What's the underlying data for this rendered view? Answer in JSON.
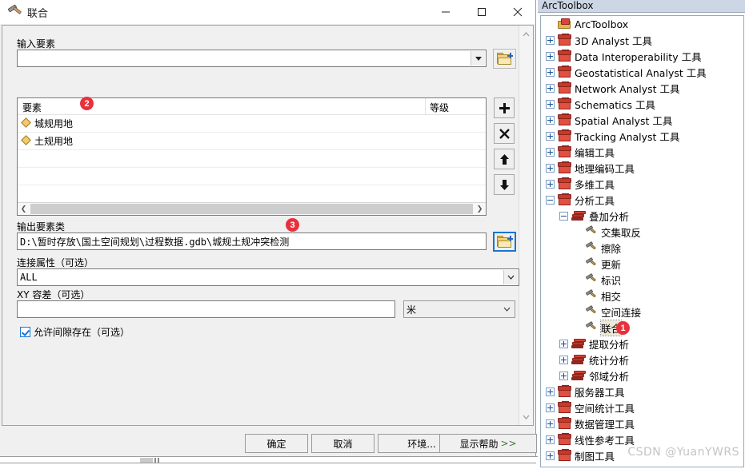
{
  "dialog": {
    "title": "联合",
    "title_icon": "hammer-icon",
    "window_buttons": {
      "minimize": "—",
      "maximize": "▢",
      "close": "✕"
    },
    "input_features": {
      "label": "输入要素",
      "value": "",
      "placeholder": "",
      "browse_icon": "folder-add-icon"
    },
    "feature_list": {
      "columns": [
        "要素",
        "等级"
      ],
      "rows": [
        {
          "icon": "polygon-diamond-icon",
          "name": "城规用地",
          "rank": ""
        },
        {
          "icon": "polygon-diamond-icon",
          "name": "土规用地",
          "rank": ""
        }
      ],
      "side_buttons": [
        {
          "name": "add-button",
          "glyph": "✚"
        },
        {
          "name": "remove-button",
          "glyph": "✖"
        },
        {
          "name": "move-up-button",
          "glyph": "⬆"
        },
        {
          "name": "move-down-button",
          "glyph": "⬇"
        }
      ]
    },
    "output_feature_class": {
      "label": "输出要素类",
      "value": "D:\\暂时存放\\国土空间规划\\过程数据.gdb\\城规土规冲突检测",
      "browse_icon": "folder-add-icon"
    },
    "join_attributes": {
      "label": "连接属性（可选）",
      "value": "ALL"
    },
    "xy_tolerance": {
      "label": "XY 容差（可选）",
      "value": "",
      "unit": "米"
    },
    "gaps_allowed": {
      "label": "允许间隙存在（可选）",
      "checked": true
    },
    "footer_buttons": [
      {
        "name": "ok-button",
        "label": "确定"
      },
      {
        "name": "cancel-button",
        "label": "取消"
      },
      {
        "name": "environments-button",
        "label": "环境..."
      },
      {
        "name": "show-help-button",
        "label": "显示帮助",
        "suffix": ">>"
      }
    ]
  },
  "toolbox": {
    "header": "ArcToolbox",
    "root": {
      "label": "ArcToolbox",
      "icon": "arctoolbox-root-icon"
    },
    "items": [
      {
        "label": "3D Analyst 工具",
        "icon": "toolbox-icon",
        "expander": "plus",
        "indent": 0
      },
      {
        "label": "Data Interoperability 工具",
        "icon": "toolbox-icon",
        "expander": "plus",
        "indent": 0
      },
      {
        "label": "Geostatistical Analyst 工具",
        "icon": "toolbox-icon",
        "expander": "plus",
        "indent": 0
      },
      {
        "label": "Network Analyst 工具",
        "icon": "toolbox-icon",
        "expander": "plus",
        "indent": 0
      },
      {
        "label": "Schematics 工具",
        "icon": "toolbox-icon",
        "expander": "plus",
        "indent": 0
      },
      {
        "label": "Spatial Analyst 工具",
        "icon": "toolbox-icon",
        "expander": "plus",
        "indent": 0
      },
      {
        "label": "Tracking Analyst 工具",
        "icon": "toolbox-icon",
        "expander": "plus",
        "indent": 0
      },
      {
        "label": "编辑工具",
        "icon": "toolbox-icon",
        "expander": "plus",
        "indent": 0
      },
      {
        "label": "地理编码工具",
        "icon": "toolbox-icon",
        "expander": "plus",
        "indent": 0
      },
      {
        "label": "多维工具",
        "icon": "toolbox-icon",
        "expander": "plus",
        "indent": 0
      },
      {
        "label": "分析工具",
        "icon": "toolbox-icon",
        "expander": "minus",
        "indent": 0
      },
      {
        "label": "叠加分析",
        "icon": "toolset-icon",
        "expander": "minus",
        "indent": 1
      },
      {
        "label": "交集取反",
        "icon": "hammer-icon",
        "expander": "none",
        "indent": 2
      },
      {
        "label": "擦除",
        "icon": "hammer-icon",
        "expander": "none",
        "indent": 2
      },
      {
        "label": "更新",
        "icon": "hammer-icon",
        "expander": "none",
        "indent": 2
      },
      {
        "label": "标识",
        "icon": "hammer-icon",
        "expander": "none",
        "indent": 2
      },
      {
        "label": "相交",
        "icon": "hammer-icon",
        "expander": "none",
        "indent": 2
      },
      {
        "label": "空间连接",
        "icon": "hammer-icon",
        "expander": "none",
        "indent": 2
      },
      {
        "label": "联合",
        "icon": "hammer-icon",
        "expander": "none",
        "indent": 2,
        "selected": true
      },
      {
        "label": "提取分析",
        "icon": "toolset-icon",
        "expander": "plus",
        "indent": 1
      },
      {
        "label": "统计分析",
        "icon": "toolset-icon",
        "expander": "plus",
        "indent": 1
      },
      {
        "label": "邻域分析",
        "icon": "toolset-icon",
        "expander": "plus",
        "indent": 1
      },
      {
        "label": "服务器工具",
        "icon": "toolbox-icon",
        "expander": "plus",
        "indent": 0
      },
      {
        "label": "空间统计工具",
        "icon": "toolbox-icon",
        "expander": "plus",
        "indent": 0
      },
      {
        "label": "数据管理工具",
        "icon": "toolbox-icon",
        "expander": "plus",
        "indent": 0
      },
      {
        "label": "线性参考工具",
        "icon": "toolbox-icon",
        "expander": "plus",
        "indent": 0
      },
      {
        "label": "制图工具",
        "icon": "toolbox-icon",
        "expander": "plus",
        "indent": 0
      }
    ]
  },
  "badges": [
    {
      "number": "1",
      "target": "toolbox-item-union"
    },
    {
      "number": "2",
      "target": "feature-list-rows"
    },
    {
      "number": "3",
      "target": "output-feature-class-input"
    }
  ],
  "watermark": "CSDN @YuanYWRS",
  "colors": {
    "badge_red": "#e8313a",
    "toolbox_red": "#d44334",
    "folder_yellow": "#f4d27a",
    "focus_blue": "#1675d1",
    "panel_header": "#ccd6e4"
  }
}
